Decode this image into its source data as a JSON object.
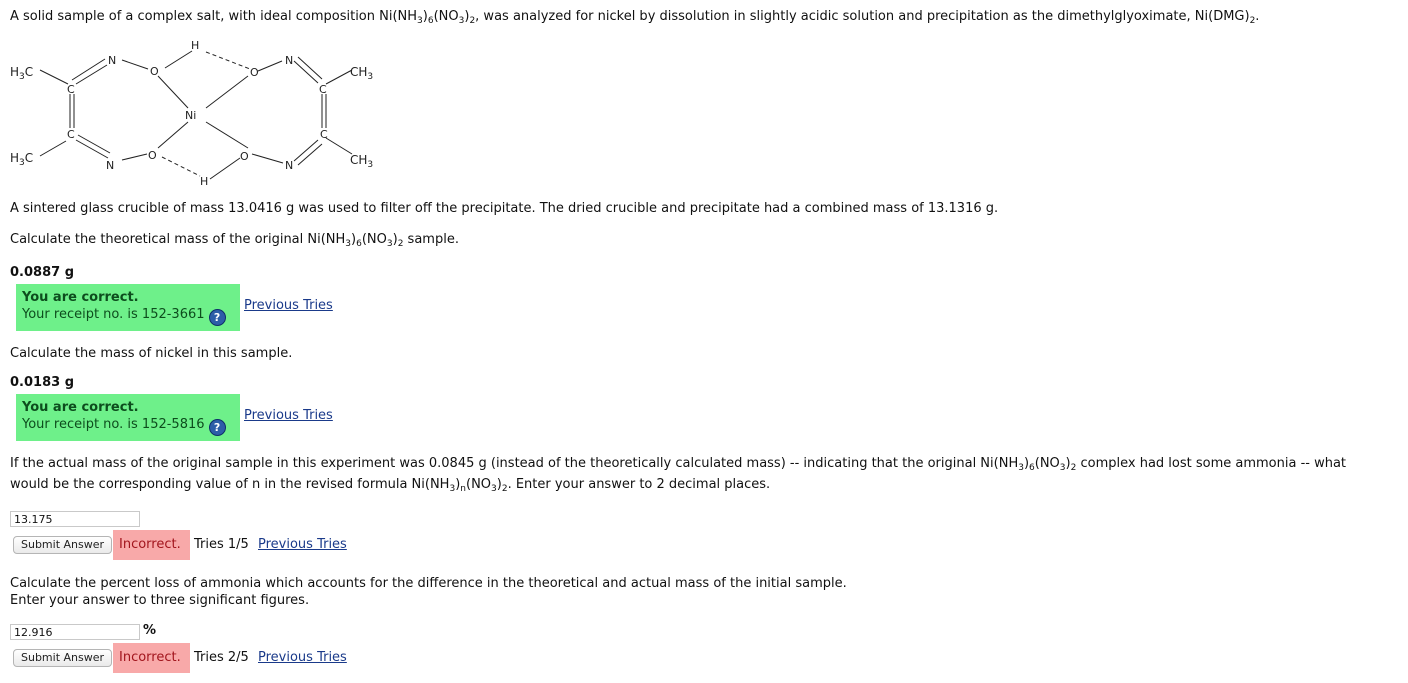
{
  "intro": {
    "text_before": "A solid sample of a complex salt, with ideal composition Ni(NH",
    "sub1": "3",
    "text_mid1": ")",
    "sub2": "6",
    "text_mid2": "(NO",
    "sub3": "3",
    "text_mid3": ")",
    "sub4": "2",
    "text_mid4": ", was analyzed for nickel by dissolution in slightly acidic solution and precipitation as the dimethylglyoximate, Ni(DMG)",
    "sub5": "2",
    "text_end": "."
  },
  "structure": {
    "atoms": {
      "h3c_top": "H3C",
      "h3c_bottom": "H3C",
      "ch3_top": "CH3",
      "ch3_bottom": "CH3",
      "n": "N",
      "o": "O",
      "c": "C",
      "h": "H",
      "ni": "Ni"
    }
  },
  "crucible_text": "A sintered glass crucible of mass 13.0416 g was used to filter off the precipitate. The dried crucible and precipitate had a combined mass of 13.1316 g.",
  "q1": {
    "prompt_a": "Calculate the theoretical mass of the original Ni(NH",
    "prompt_s1": "3",
    "prompt_b": ")",
    "prompt_s2": "6",
    "prompt_c": "(NO",
    "prompt_s3": "3",
    "prompt_d": ")",
    "prompt_s4": "2",
    "prompt_e": " sample.",
    "answer": "0.0887 g",
    "status_title": "You are correct.",
    "receipt": "Your receipt no. is 152-3661",
    "previous_tries": "Previous Tries"
  },
  "q2": {
    "prompt": "Calculate the mass of nickel in this sample.",
    "answer": "0.0183 g",
    "status_title": "You are correct.",
    "receipt": "Your receipt no. is 152-5816",
    "previous_tries": "Previous Tries"
  },
  "q3": {
    "line1_a": "If the actual mass of the original sample in this experiment was 0.0845 g (instead of the theoretically calculated mass) -- indicating that the original Ni(NH",
    "line1_s1": "3",
    "line1_b": ")",
    "line1_s2": "6",
    "line1_c": "(NO",
    "line1_s3": "3",
    "line1_d": ")",
    "line1_s4": "2",
    "line1_e": " complex had lost some ammonia -- what",
    "line2_a": "would be the corresponding value of n in the revised formula Ni(NH",
    "line2_s1": "3",
    "line2_b": ")",
    "line2_s2": "n",
    "line2_c": "(NO",
    "line2_s3": "3",
    "line2_d": ")",
    "line2_s4": "2",
    "line2_e": ". Enter your answer to 2 decimal places.",
    "input_value": "13.175",
    "submit_label": "Submit Answer",
    "status": "Incorrect.",
    "tries": "Tries 1/5",
    "previous_tries": "Previous Tries"
  },
  "q4": {
    "line1": "Calculate the percent loss of ammonia which accounts for the difference in the theoretical and actual mass of the initial sample.",
    "line2": "Enter your answer to three significant figures.",
    "input_value": "12.916",
    "unit": "%",
    "submit_label": "Submit Answer",
    "status": "Incorrect.",
    "tries": "Tries 2/5",
    "previous_tries": "Previous Tries"
  },
  "colors": {
    "correct_bg": "#6ef08a",
    "incorrect_bg": "#f8a9a9",
    "link": "#1a3a8a"
  },
  "icons": {
    "help": "question-circle-icon"
  }
}
